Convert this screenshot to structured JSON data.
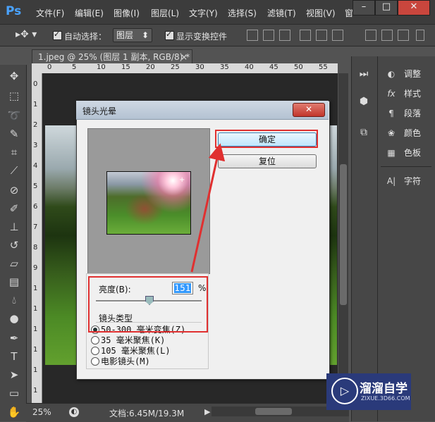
{
  "app": {
    "logo": "Ps"
  },
  "menubar": {
    "items": [
      "文件(F)",
      "编辑(E)",
      "图像(I)",
      "图层(L)",
      "文字(Y)",
      "选择(S)",
      "滤镜(T)",
      "视图(V)",
      "窗"
    ],
    "window_controls": {
      "minimize": "–",
      "maximize": "□",
      "close": "✕"
    }
  },
  "options": {
    "auto_select_label": "自动选择：",
    "auto_select_value": "图层",
    "show_transform_label": "显示变换控件"
  },
  "document": {
    "tab_title": "1.jpeg @ 25% (图层 1 副本, RGB/8) *",
    "tab_close": "×",
    "ruler_h_ticks": [
      "0",
      "5",
      "10",
      "15",
      "20",
      "25",
      "30",
      "35",
      "40",
      "45",
      "50",
      "55"
    ],
    "ruler_v_ticks": [
      "0",
      "1",
      "2",
      "3",
      "4",
      "5",
      "6",
      "7",
      "8",
      "9",
      "1",
      "1",
      "1",
      "1",
      "1",
      "1"
    ]
  },
  "status": {
    "zoom": "25%",
    "doc_info": "文档:6.45M/19.3M"
  },
  "panels": {
    "items": [
      {
        "label": "调整",
        "icon": "adjustments-icon",
        "glyph": "◐"
      },
      {
        "label": "样式",
        "icon": "styles-icon",
        "glyph": "fx"
      },
      {
        "label": "段落",
        "icon": "paragraph-icon",
        "glyph": "¶"
      },
      {
        "label": "颜色",
        "icon": "color-icon",
        "glyph": "❀"
      },
      {
        "label": "色板",
        "icon": "swatches-icon",
        "glyph": "▦"
      },
      {
        "label": "字符",
        "icon": "character-icon",
        "glyph": "A|"
      }
    ]
  },
  "dialog": {
    "title": "镜头光晕",
    "close": "✕",
    "ok_label": "确定",
    "reset_label": "复位",
    "brightness_label": "亮度(B):",
    "brightness_value": "151",
    "brightness_unit": "%",
    "lens_type_label": "镜头类型",
    "lens_options": [
      {
        "label": "50-300 毫米变焦(Z)",
        "selected": true
      },
      {
        "label": "35 毫米聚焦(K)",
        "selected": false
      },
      {
        "label": "105 毫米聚焦(L)",
        "selected": false
      },
      {
        "label": "电影镜头(M)",
        "selected": false
      }
    ],
    "brightness_fraction": 0.5,
    "center_marker": "+"
  },
  "watermark": {
    "name": "溜溜自学",
    "url": "ZIXUE.3D66.COM"
  },
  "colors": {
    "highlight": "#e03030",
    "ps_blue": "#4aa3ff",
    "watermark_bg": "#2a3a7a"
  }
}
